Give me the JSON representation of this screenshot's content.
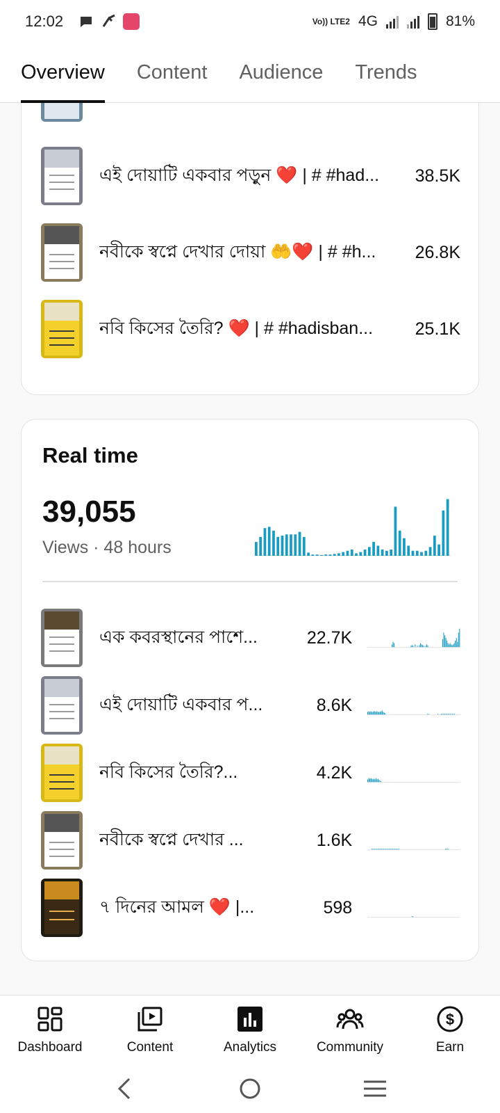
{
  "status_bar": {
    "time": "12:02",
    "network": "4G",
    "volte": "Vo)) LTE2",
    "battery": "81%"
  },
  "tabs": [
    {
      "label": "Overview",
      "active": true
    },
    {
      "label": "Content",
      "active": false
    },
    {
      "label": "Audience",
      "active": false
    },
    {
      "label": "Trends",
      "active": false
    }
  ],
  "top_content": {
    "rows": [
      {
        "title": "এই দোয়াটি একবার পড়ুন ❤️ | # #had...",
        "views": "38.5K"
      },
      {
        "title": "নবীকে স্বপ্নে দেখার দোয়া 🤲❤️ | # #h...",
        "views": "26.8K"
      },
      {
        "title": "নবি কিসের তৈরি?  ❤️ | # #hadisban...",
        "views": "25.1K"
      }
    ]
  },
  "realtime": {
    "title": "Real time",
    "views": "39,055",
    "subtitle": "Views · 48 hours",
    "accent": "#1a9bc2",
    "chart_data": {
      "type": "bar",
      "values": [
        22,
        30,
        44,
        46,
        40,
        30,
        32,
        34,
        34,
        34,
        38,
        30,
        5,
        2,
        2,
        1,
        2,
        2,
        3,
        4,
        6,
        8,
        10,
        4,
        6,
        10,
        14,
        22,
        16,
        10,
        8,
        10,
        78,
        40,
        28,
        16,
        8,
        8,
        6,
        8,
        14,
        32,
        18,
        72,
        90
      ],
      "ylim": [
        0,
        95
      ]
    },
    "rows": [
      {
        "title": "এক কবরস্থানের পাশে...",
        "views": "22.7K",
        "spark": [
          0,
          0,
          0,
          0,
          0,
          0,
          0,
          0,
          0,
          0,
          0,
          0,
          0,
          0,
          0,
          0,
          0,
          0,
          0,
          0,
          0,
          0,
          0,
          4,
          8,
          6,
          0,
          0,
          0,
          0,
          0,
          0,
          0,
          0,
          0,
          0,
          0,
          0,
          0,
          0,
          0,
          2,
          3,
          2,
          0,
          4,
          0,
          2,
          0,
          3,
          6,
          4,
          3,
          2,
          0,
          2,
          4,
          2,
          0,
          0,
          0,
          0,
          0,
          0,
          0,
          0,
          0,
          0,
          0,
          0,
          0,
          12,
          22,
          18,
          14,
          10,
          6,
          4,
          6,
          4,
          3,
          4,
          6,
          10,
          14,
          8,
          22,
          28
        ]
      },
      {
        "title": "এই দোয়াটি একবার প...",
        "views": "8.6K",
        "spark": [
          4,
          5,
          4,
          5,
          4,
          4,
          5,
          5,
          4,
          5,
          4,
          4,
          4,
          5,
          6,
          4,
          3,
          2,
          0,
          0,
          0,
          0,
          0,
          0,
          0,
          0,
          0,
          0,
          0,
          0,
          0,
          0,
          0,
          0,
          0,
          0,
          0,
          0,
          0,
          0,
          0,
          0,
          0,
          0,
          0,
          0,
          0,
          0,
          0,
          0,
          0,
          0,
          0,
          0,
          0,
          0,
          0,
          0,
          1,
          1,
          0,
          0,
          0,
          0,
          0,
          0,
          0,
          0,
          1,
          0,
          0,
          1,
          1,
          1,
          1,
          1,
          1,
          1,
          1,
          1,
          1,
          1,
          1,
          1,
          1,
          0,
          0,
          0,
          0,
          0
        ]
      },
      {
        "title": "নবি কিসের তৈরি?...",
        "views": "4.2K",
        "spark": [
          4,
          6,
          5,
          6,
          5,
          4,
          5,
          4,
          6,
          4,
          5,
          3,
          2,
          1,
          0,
          0,
          0,
          0,
          0,
          0,
          0,
          0,
          0,
          0,
          0,
          0,
          0,
          0,
          0,
          0,
          0,
          0,
          0,
          0,
          0,
          0,
          0,
          0,
          0,
          0,
          0,
          0,
          0,
          0,
          0,
          0,
          0,
          0,
          0,
          0,
          0,
          0,
          0,
          0,
          0,
          0,
          0,
          0,
          0,
          0,
          0,
          0,
          0,
          0,
          0,
          0,
          0,
          0,
          0,
          0,
          0,
          0,
          0,
          0,
          0,
          0,
          0,
          0,
          0,
          0,
          0,
          0,
          0,
          0,
          0,
          0,
          0,
          0,
          0,
          0
        ]
      },
      {
        "title": "নবীকে স্বপ্নে দেখার ...",
        "views": "1.6K",
        "spark": [
          0,
          0,
          0,
          0,
          1,
          1,
          1,
          1,
          1,
          1,
          1,
          1,
          1,
          1,
          1,
          1,
          1,
          1,
          1,
          1,
          1,
          1,
          1,
          1,
          1,
          1,
          1,
          1,
          1,
          1,
          1,
          1,
          0,
          0,
          0,
          0,
          0,
          0,
          0,
          0,
          0,
          0,
          0,
          0,
          0,
          0,
          0,
          0,
          0,
          0,
          0,
          0,
          0,
          0,
          0,
          0,
          0,
          0,
          0,
          0,
          0,
          0,
          0,
          0,
          0,
          0,
          0,
          0,
          0,
          0,
          0,
          0,
          0,
          0,
          0,
          0,
          0,
          1,
          1,
          1,
          1,
          0,
          0,
          0,
          0,
          0,
          0,
          0,
          0,
          0,
          0,
          0
        ]
      },
      {
        "title": "৭ দিনের আমল ❤️ |...",
        "views": "598",
        "spark": [
          0,
          0,
          0,
          0,
          0,
          0,
          0,
          0,
          0,
          0,
          0,
          0,
          0,
          0,
          0,
          0,
          0,
          0,
          0,
          0,
          0,
          0,
          0,
          0,
          0,
          0,
          0,
          0,
          0,
          0,
          0,
          0,
          0,
          0,
          0,
          0,
          0,
          0,
          0,
          0,
          0,
          0,
          0,
          1,
          1,
          0,
          0,
          0,
          0,
          0,
          0,
          0,
          0,
          0,
          0,
          0,
          0,
          0,
          0,
          0,
          0,
          0,
          0,
          0,
          0,
          0,
          0,
          0,
          0,
          0,
          0,
          0,
          0,
          0,
          0,
          0,
          0,
          0,
          0,
          0,
          0,
          0,
          0,
          0,
          0,
          0,
          0,
          0,
          0,
          0
        ]
      }
    ]
  },
  "bottom_nav": [
    {
      "label": "Dashboard",
      "icon": "dashboard-icon"
    },
    {
      "label": "Content",
      "icon": "content-icon"
    },
    {
      "label": "Analytics",
      "icon": "analytics-icon"
    },
    {
      "label": "Community",
      "icon": "community-icon"
    },
    {
      "label": "Earn",
      "icon": "earn-icon"
    }
  ]
}
